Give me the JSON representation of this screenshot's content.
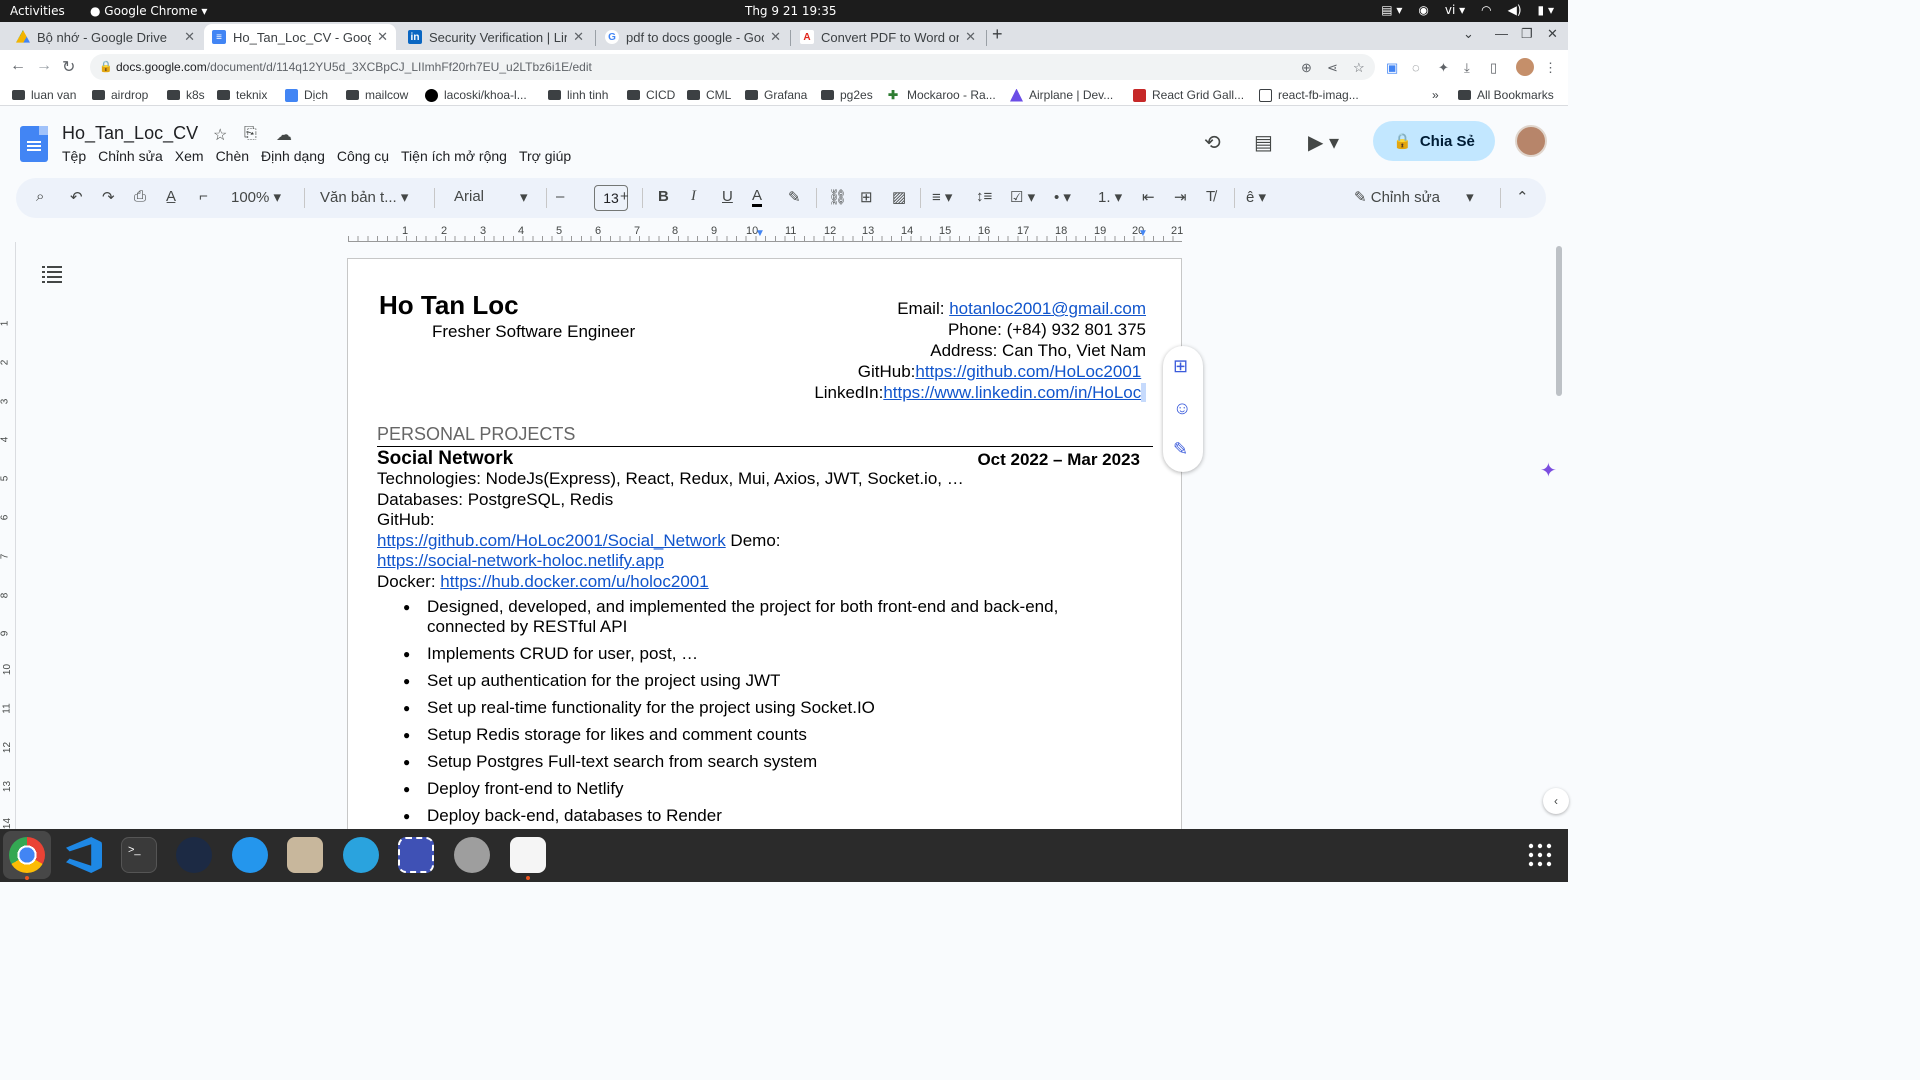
{
  "system": {
    "activities": "Activities",
    "app_name": "Google Chrome",
    "clock": "Thg 9 21  19:35",
    "lang": "vi"
  },
  "tabs": [
    {
      "label": "Bộ nhớ - Google Drive",
      "icon": "google-drive-icon",
      "active": false
    },
    {
      "label": "Ho_Tan_Loc_CV - Google",
      "icon": "google-docs-icon",
      "active": true
    },
    {
      "label": "Security Verification | Link",
      "icon": "linkedin-icon",
      "active": false
    },
    {
      "label": "pdf to docs google - Goog",
      "icon": "google-icon",
      "active": false
    },
    {
      "label": "Convert PDF to Word onli",
      "icon": "adobe-icon",
      "active": false
    }
  ],
  "address": {
    "domain": "docs.google.com",
    "path": "/document/d/114q12YU5d_3XCBpCJ_LIImhFf20rh7EU_u2LTbz6i1E/edit"
  },
  "bookmarks": [
    {
      "label": "luan van",
      "type": "folder"
    },
    {
      "label": "airdrop",
      "type": "folder"
    },
    {
      "label": "k8s",
      "type": "folder"
    },
    {
      "label": "teknix",
      "type": "folder"
    },
    {
      "label": "Dịch",
      "type": "translate"
    },
    {
      "label": "mailcow",
      "type": "folder"
    },
    {
      "label": "lacoski/khoa-l...",
      "type": "github"
    },
    {
      "label": "linh tinh",
      "type": "folder"
    },
    {
      "label": "CICD",
      "type": "folder"
    },
    {
      "label": "CML",
      "type": "folder"
    },
    {
      "label": "Grafana",
      "type": "folder"
    },
    {
      "label": "pg2es",
      "type": "folder"
    },
    {
      "label": "Mockaroo - Ra...",
      "type": "site"
    },
    {
      "label": "Airplane | Dev...",
      "type": "site"
    },
    {
      "label": "React Grid Gall...",
      "type": "site"
    },
    {
      "label": "react-fb-imag...",
      "type": "page"
    }
  ],
  "bookmarks_more": "»",
  "all_bookmarks": "All Bookmarks",
  "docs": {
    "title": "Ho_Tan_Loc_CV",
    "menu": [
      "Tệp",
      "Chỉnh sửa",
      "Xem",
      "Chèn",
      "Định dạng",
      "Công cụ",
      "Tiện ích mở rộng",
      "Trợ giúp"
    ],
    "share_label": "Chia Sẻ",
    "zoom": "100%",
    "style": "Văn bản t...",
    "font": "Arial",
    "font_size": "13",
    "mode": "Chỉnh sửa",
    "accent_color": "#c2e7ff"
  },
  "ruler_numbers": [
    "1",
    "2",
    "3",
    "4",
    "5",
    "6",
    "7",
    "8",
    "9",
    "10",
    "11",
    "12",
    "13",
    "14",
    "15",
    "16",
    "17",
    "18",
    "19",
    "20",
    "21"
  ],
  "vruler_numbers": [
    "1",
    "2",
    "3",
    "4",
    "5",
    "6",
    "7",
    "8",
    "9",
    "10",
    "11",
    "12",
    "13",
    "14"
  ],
  "cv": {
    "name": "Ho Tan Loc",
    "role": "Fresher Software Engineer",
    "email_label": "Email: ",
    "email": "hotanloc2001@gmail.com",
    "phone": "Phone: (+84) 932 801 375",
    "address": "Address: Can Tho, Viet Nam",
    "github_label": "GitHub:",
    "github": "https://github.com/HoLoc2001",
    "linkedin_label": "LinkedIn:",
    "linkedin": "https://www.linkedin.com/in/HoLoc",
    "section": "PERSONAL PROJECTS",
    "project": {
      "title": "Social Network",
      "date": "Oct 2022 – Mar 2023",
      "technologies": "Technologies: NodeJs(Express), React, Redux, Mui, Axios, JWT, Socket.io, …",
      "databases": "Databases: PostgreSQL, Redis",
      "github_label": "GitHub:",
      "github_url": "https://github.com/HoLoc2001/Social_Network",
      "demo_label": " Demo:",
      "demo_url": "https://social-network-holoc.netlify.app",
      "docker_label": "Docker: ",
      "docker_url": "https://hub.docker.com/u/holoc2001",
      "bullets": [
        "Designed, developed, and implemented the project for both front-end and back-end, connected by RESTful API",
        "Implements CRUD for user, post, …",
        "Set up authentication for the project using JWT",
        "Set up real-time functionality for the project using Socket.IO",
        "Setup Redis storage for likes and comment counts",
        "Setup Postgres Full-text search from search system",
        "Deploy front-end to Netlify",
        "Deploy back-end, databases to Render"
      ]
    }
  },
  "dock": [
    "chrome",
    "vscode",
    "terminal",
    "dbeaver",
    "docker",
    "files",
    "telegram",
    "screenshot",
    "settings",
    "text-editor"
  ]
}
